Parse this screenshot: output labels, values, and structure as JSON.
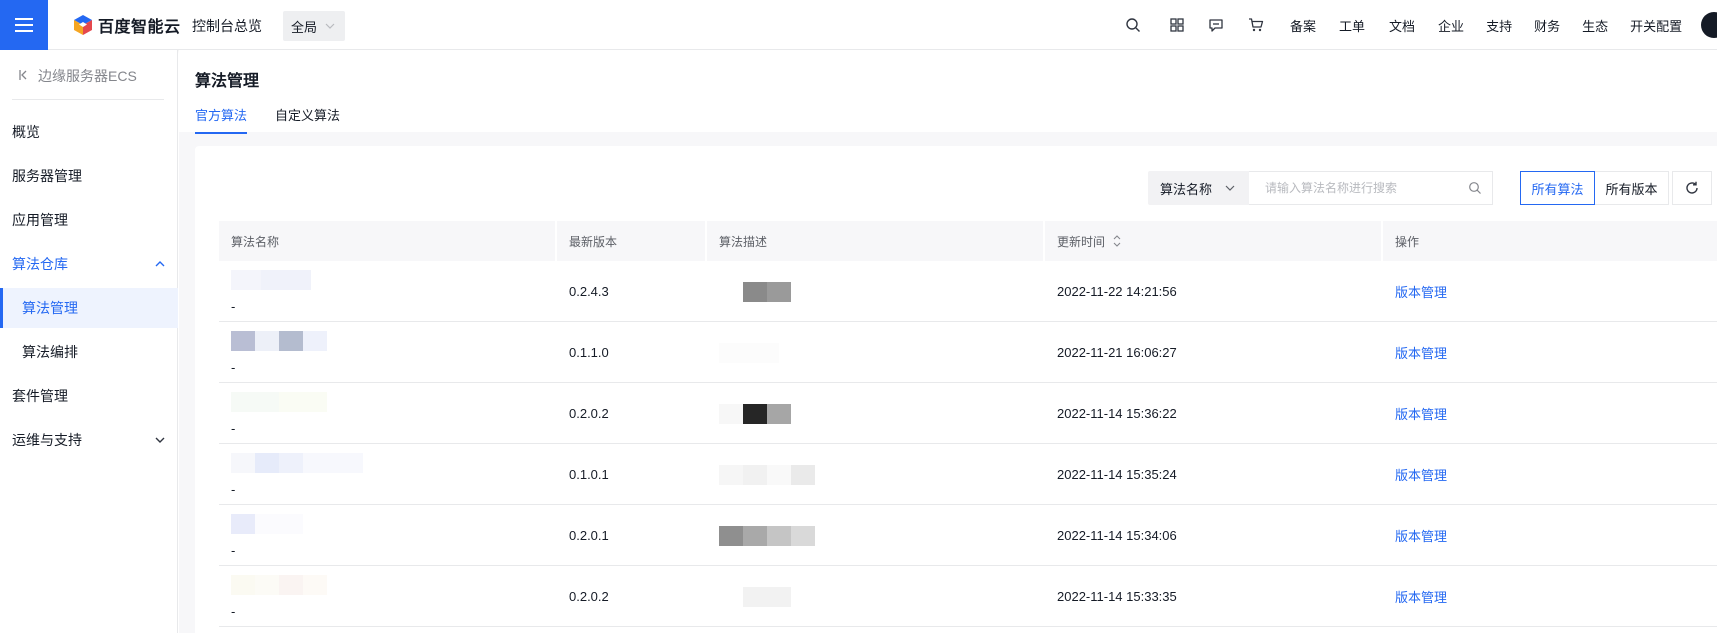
{
  "topbar": {
    "brand": "百度智能云",
    "console_overview": "控制台总览",
    "region": "全局",
    "links": [
      "备案",
      "工单",
      "文档",
      "企业",
      "支持",
      "财务",
      "生态",
      "开关配置"
    ]
  },
  "sidebar": {
    "product": "边缘服务器ECS",
    "items": [
      {
        "label": "概览"
      },
      {
        "label": "服务器管理"
      },
      {
        "label": "应用管理"
      },
      {
        "label": "算法仓库"
      },
      {
        "label": "算法管理"
      },
      {
        "label": "算法编排"
      },
      {
        "label": "套件管理"
      },
      {
        "label": "运维与支持"
      }
    ]
  },
  "page": {
    "title": "算法管理",
    "tabs": [
      "官方算法",
      "自定义算法"
    ]
  },
  "toolbar": {
    "search_key": "算法名称",
    "search_placeholder": "请输入算法名称进行搜索",
    "filter_all_algorithms": "所有算法",
    "filter_all_versions": "所有版本"
  },
  "table": {
    "columns": [
      "算法名称",
      "最新版本",
      "算法描述",
      "更新时间",
      "操作"
    ],
    "rows": [
      {
        "name": "-",
        "version": "0.2.4.3",
        "updated": "2022-11-22 14:21:56",
        "action": "版本管理"
      },
      {
        "name": "-",
        "version": "0.1.1.0",
        "updated": "2022-11-21 16:06:27",
        "action": "版本管理"
      },
      {
        "name": "-",
        "version": "0.2.0.2",
        "updated": "2022-11-14 15:36:22",
        "action": "版本管理"
      },
      {
        "name": "-",
        "version": "0.1.0.1",
        "updated": "2022-11-14 15:35:24",
        "action": "版本管理"
      },
      {
        "name": "-",
        "version": "0.2.0.1",
        "updated": "2022-11-14 15:34:06",
        "action": "版本管理"
      },
      {
        "name": "-",
        "version": "0.2.0.2",
        "updated": "2022-11-14 15:33:35",
        "action": "版本管理"
      }
    ]
  },
  "colors": {
    "primary": "#2468f2",
    "text": "#151b26",
    "muted": "#84868c",
    "page_bg": "#f7f7f9"
  }
}
